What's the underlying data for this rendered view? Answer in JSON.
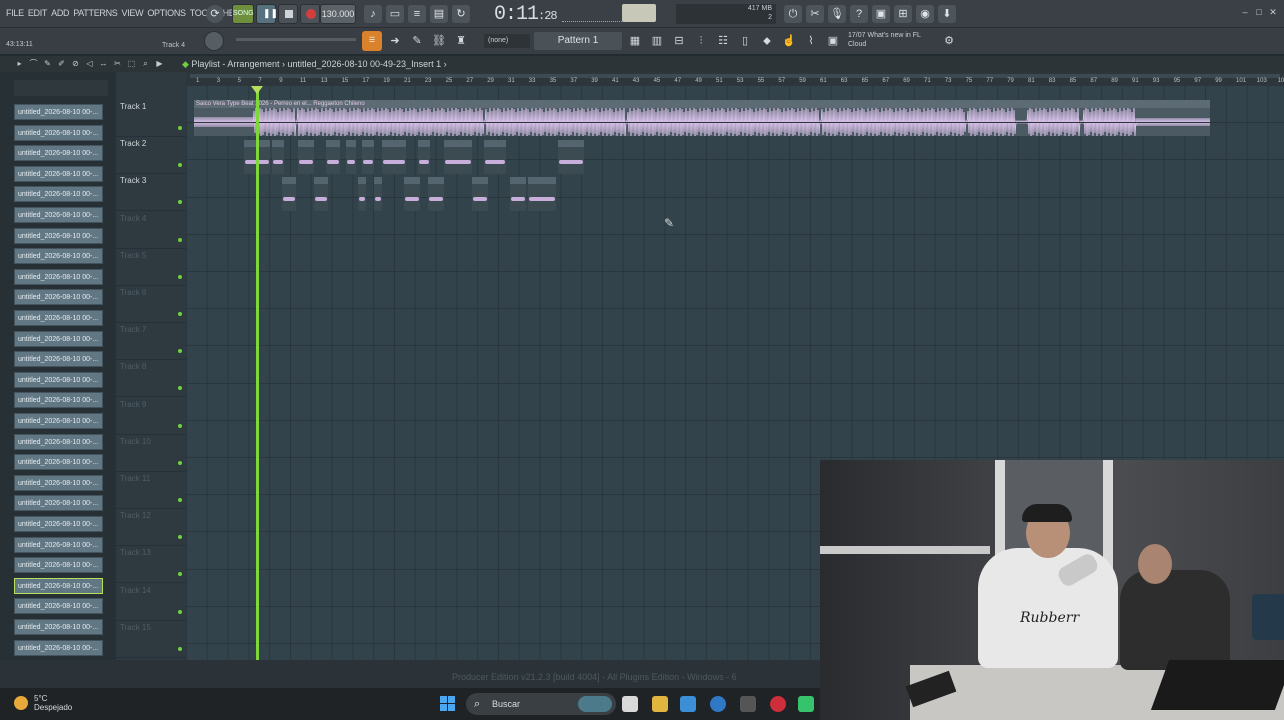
{
  "menu": [
    "FILE",
    "EDIT",
    "ADD",
    "PATTERNS",
    "VIEW",
    "OPTIONS",
    "TOOLS",
    "HELP"
  ],
  "transport": {
    "pat_label": "SONG",
    "tempo": "130.000",
    "time": "0:11",
    "time_small": "28"
  },
  "cpu": {
    "mem": "417 MB",
    "voices": "2"
  },
  "hint": {
    "left": "43:13:11",
    "track": "Track 4"
  },
  "snap_label": "☰",
  "none_label": "(none)",
  "pattern_label": "Pattern 1",
  "news": {
    "line1": "17/07  What's new in FL",
    "line2": "Cloud"
  },
  "playlist": {
    "title": "Playlist - Arrangement",
    "breadcrumb": "untitled_2026-08-10 00-49-23_Insert 1"
  },
  "picker_items": [
    "untitled_2026-08-10 00-...",
    "untitled_2026-08-10 00-...",
    "untitled_2026-08-10 00-...",
    "untitled_2026-08-10 00-...",
    "untitled_2026-08-10 00-...",
    "untitled_2026-08-10 00-...",
    "untitled_2026-08-10 00-...",
    "untitled_2026-08-10 00-...",
    "untitled_2026-08-10 00-...",
    "untitled_2026-08-10 00-...",
    "untitled_2026-08-10 00-...",
    "untitled_2026-08-10 00-...",
    "untitled_2026-08-10 00-...",
    "untitled_2026-08-10 00-...",
    "untitled_2026-08-10 00-...",
    "untitled_2026-08-10 00-...",
    "untitled_2026-08-10 00-...",
    "untitled_2026-08-10 00-...",
    "untitled_2026-08-10 00-...",
    "untitled_2026-08-10 00-...",
    "untitled_2026-08-10 00-...",
    "untitled_2026-08-10 00-...",
    "untitled_2026-08-10 00-...",
    "untitled_2026-08-10 00-...",
    "untitled_2026-08-10 00-...",
    "untitled_2026-08-10 00-...",
    "untitled_2026-08-10 00-..."
  ],
  "tracks": [
    "Track 1",
    "Track 2",
    "Track 3",
    "Track 4",
    "Track 5",
    "Track 6",
    "Track 7",
    "Track 8",
    "Track 9",
    "Track 10",
    "Track 11",
    "Track 12",
    "Track 13",
    "Track 14",
    "Track 15"
  ],
  "main_clip_title": "Saico Vera Type Beat 2026 - Perreo en el... Reggaeton Chileno",
  "version": "Producer Edition v21.2.3 [build 4004] - All Plugins Edition - Windows - 6",
  "taskbar": {
    "temp": "5°C",
    "weather": "Despejado",
    "search": "Buscar"
  },
  "cam_text": "Rubberr"
}
